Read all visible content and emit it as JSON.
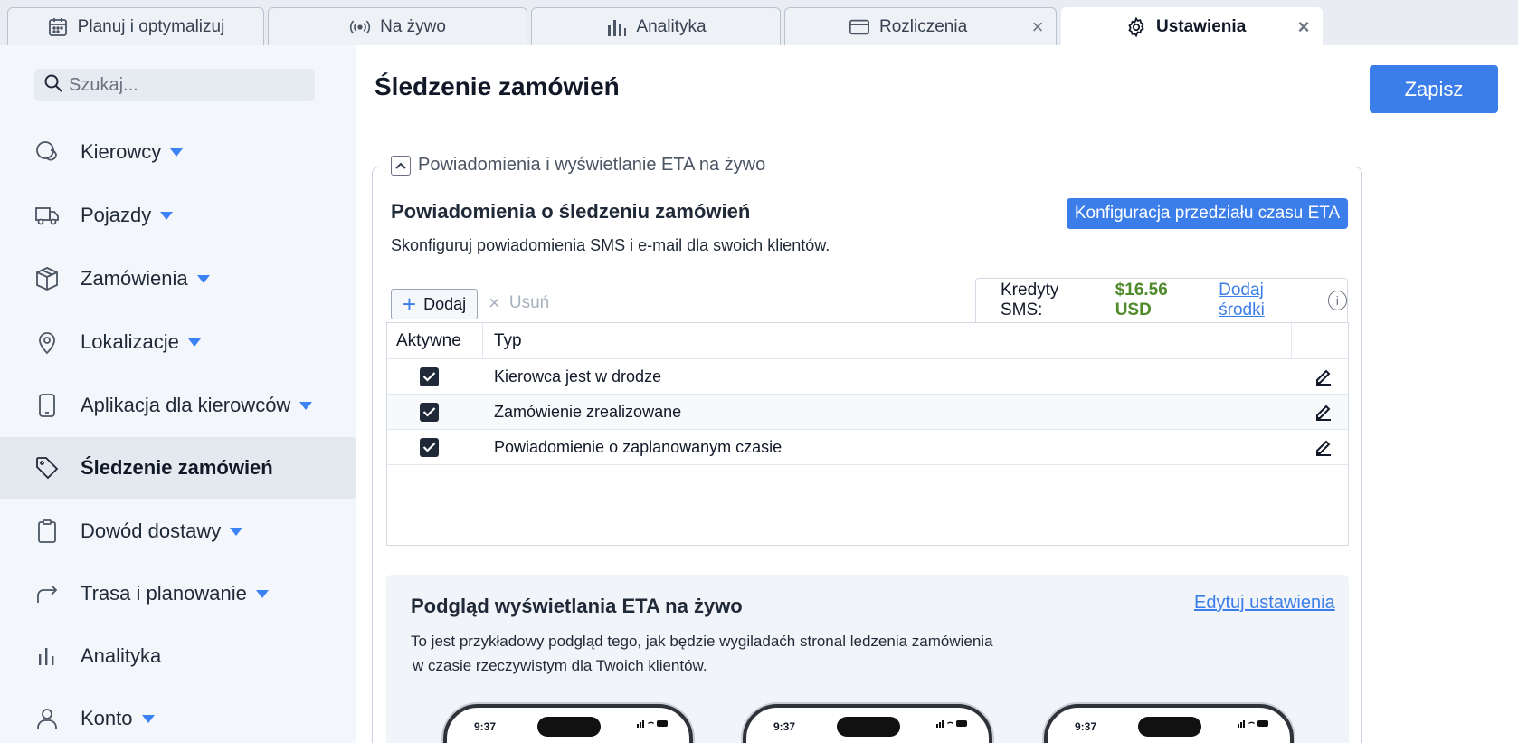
{
  "tabs": [
    {
      "label": "Planuj i optymalizuj",
      "icon": "calendar-icon"
    },
    {
      "label": "Na żywo",
      "icon": "broadcast-icon"
    },
    {
      "label": "Analityka",
      "icon": "bar-chart-icon"
    },
    {
      "label": "Rozliczenia",
      "icon": "credit-card-icon",
      "closable": true
    },
    {
      "label": "Ustawienia",
      "icon": "gear-icon",
      "closable": true,
      "active": true
    }
  ],
  "sidebar": {
    "search_placeholder": "Szukaj...",
    "items": [
      {
        "label": "Kierowcy",
        "icon": "drivers-icon",
        "has_caret": true
      },
      {
        "label": "Pojazdy",
        "icon": "truck-icon",
        "has_caret": true
      },
      {
        "label": "Zamówienia",
        "icon": "box-icon",
        "has_caret": true
      },
      {
        "label": "Lokalizacje",
        "icon": "map-pin-icon",
        "has_caret": true
      },
      {
        "label": "Aplikacja dla kierowców",
        "icon": "phone-icon",
        "has_caret": true
      },
      {
        "label": "Śledzenie zamówień",
        "icon": "tag-icon",
        "has_caret": false,
        "active": true
      },
      {
        "label": "Dowód dostawy",
        "icon": "clipboard-icon",
        "has_caret": true
      },
      {
        "label": "Trasa i planowanie",
        "icon": "route-arrow-icon",
        "has_caret": true
      },
      {
        "label": "Analityka",
        "icon": "bar-chart-icon",
        "has_caret": false
      },
      {
        "label": "Konto",
        "icon": "user-icon",
        "has_caret": true
      }
    ]
  },
  "main": {
    "title": "Śledzenie zamówień",
    "save_label": "Zapisz",
    "section": {
      "legend": "Powiadomienia i wyświetlanie ETA na żywo",
      "title": "Powiadomienia o śledzeniu zamówień",
      "description": "Skonfiguruj powiadomienia SMS i e-mail dla swoich klientów.",
      "eta_button": "Konfiguracja przedziału czasu ETA",
      "add_label": "Dodaj",
      "delete_label": "Usuń",
      "credits": {
        "label": "Kredyty SMS:",
        "amount": "$16.56 USD",
        "link": "Dodaj środki"
      },
      "table": {
        "columns": [
          "Aktywne",
          "Typ"
        ],
        "rows": [
          {
            "active": true,
            "type": "Kierowca jest w drodze"
          },
          {
            "active": true,
            "type": "Zamówienie zrealizowane"
          },
          {
            "active": true,
            "type": "Powiadomienie o zaplanowanym czasie"
          }
        ]
      }
    },
    "preview": {
      "title": "Podgląd wyświetlania ETA na żywo",
      "link": "Edytuj ustawienia",
      "description_line1": "To jest przykładowy podgląd tego, jak będzie wygiladaćh stronal ledzenia zamówienia",
      "description_line2": "w czasie rzeczywistym dla Twoich klientów.",
      "phone_time": "9:37"
    }
  },
  "colors": {
    "accent": "#3b7de9",
    "credit_amount": "#4f8a2b",
    "sidebar_bg": "#f3f6fa"
  }
}
